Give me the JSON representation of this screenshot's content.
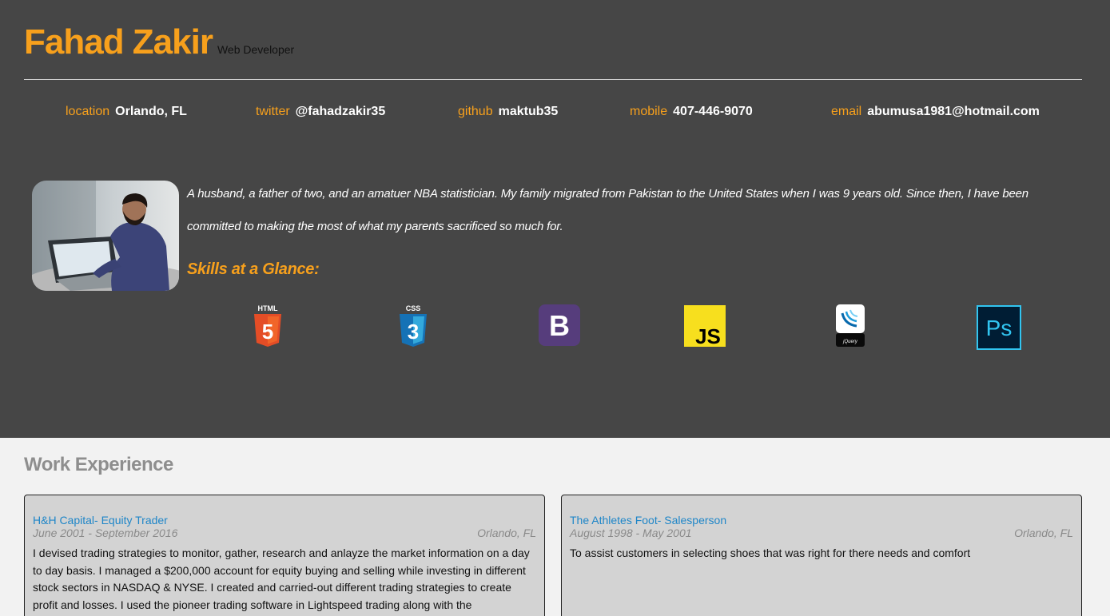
{
  "header": {
    "name": "Fahad Zakir",
    "role": "Web Developer"
  },
  "contacts": [
    {
      "label": "location",
      "value": "Orlando, FL"
    },
    {
      "label": "twitter",
      "value": "@fahadzakir35"
    },
    {
      "label": "github",
      "value": "maktub35"
    },
    {
      "label": "mobile",
      "value": "407-446-9070"
    },
    {
      "label": "email",
      "value": "abumusa1981@hotmail.com"
    }
  ],
  "bio": "A husband, a father of two, and an amatuer NBA statistician. My family migrated from Pakistan to the United States when I was 9 years old. Since then, I have been committed to making the most of what my parents sacrificed so much for.",
  "skills": {
    "title": "Skills at a Glance:",
    "items": [
      {
        "name": "html5-icon",
        "label": "HTML",
        "glyph": "5"
      },
      {
        "name": "css3-icon",
        "label": "CSS",
        "glyph": "3"
      },
      {
        "name": "bootstrap-icon",
        "glyph": "B"
      },
      {
        "name": "javascript-icon",
        "glyph": "JS"
      },
      {
        "name": "jquery-icon",
        "label": "jQuery"
      },
      {
        "name": "photoshop-icon",
        "glyph": "Ps"
      }
    ]
  },
  "work": {
    "title": "Work Experience",
    "jobs": [
      {
        "title": "H&H Capital- Equity Trader",
        "dates": "June 2001 - September 2016",
        "location": "Orlando, FL",
        "description": "I devised trading strategies to monitor, gather, research and anlayze the market information on a day to day basis. I managed a $200,000 account for equity buying and selling while investing in different stock sectors in NASDAQ & NYSE. I created and carried-out different trading strategies to create profit and losses. I used the pioneer trading software in Lightspeed trading along with the"
      },
      {
        "title": "The Athletes Foot- Salesperson",
        "dates": "August 1998 - May 2001",
        "location": "Orlando, FL",
        "description": "To assist customers in selecting shoes that was right for there needs and comfort"
      }
    ]
  },
  "colors": {
    "accent": "#f7a01c",
    "hero_bg": "#464646",
    "link": "#1f86c8"
  }
}
